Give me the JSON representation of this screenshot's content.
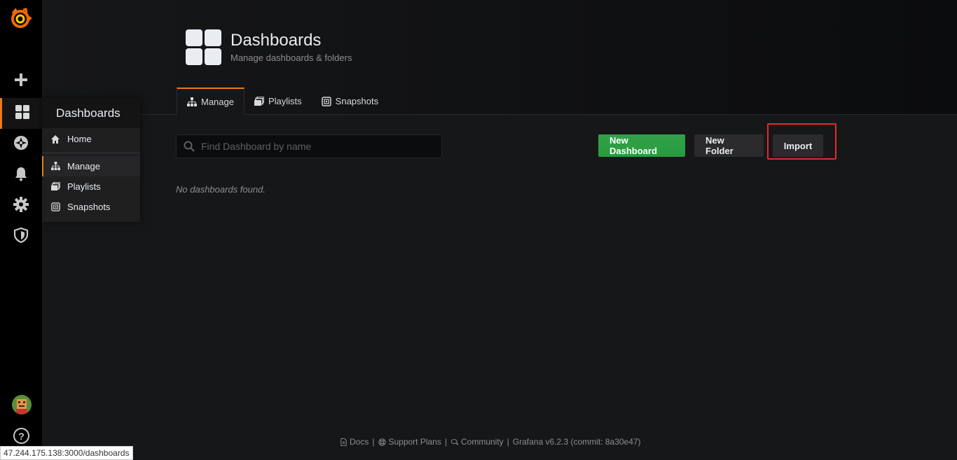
{
  "sidemenu": {
    "items": [
      {
        "name": "create",
        "icon": "plus-icon"
      },
      {
        "name": "dashboards",
        "icon": "apps-icon",
        "active": true
      },
      {
        "name": "explore",
        "icon": "compass-icon"
      },
      {
        "name": "alerting",
        "icon": "bell-icon"
      },
      {
        "name": "configuration",
        "icon": "gear-icon"
      },
      {
        "name": "server-admin",
        "icon": "shield-icon"
      }
    ],
    "help": "?"
  },
  "flyout": {
    "title": "Dashboards",
    "items": [
      {
        "label": "Home",
        "icon": "home-icon"
      },
      {
        "label": "Manage",
        "icon": "sitemap-icon",
        "active": true
      },
      {
        "label": "Playlists",
        "icon": "playlist-icon"
      },
      {
        "label": "Snapshots",
        "icon": "snapshot-icon"
      }
    ]
  },
  "header": {
    "title": "Dashboards",
    "subtitle": "Manage dashboards & folders",
    "tabs": [
      {
        "label": "Manage",
        "active": true
      },
      {
        "label": "Playlists"
      },
      {
        "label": "Snapshots"
      }
    ]
  },
  "main": {
    "search_placeholder": "Find Dashboard by name",
    "new_dashboard_label": "New Dashboard",
    "new_folder_label": "New Folder",
    "import_label": "Import",
    "empty_message": "No dashboards found."
  },
  "footer": {
    "docs": "Docs",
    "support": "Support Plans",
    "community": "Community",
    "version": "Grafana v6.2.3 (commit: 8a30e47)",
    "separator": "|"
  },
  "status_bar": {
    "url": "47.244.175.138:3000/dashboards"
  },
  "colors": {
    "accent": "#eb7b18",
    "success": "#299c3d",
    "highlight": "#e32b2b",
    "background": "#161719"
  }
}
